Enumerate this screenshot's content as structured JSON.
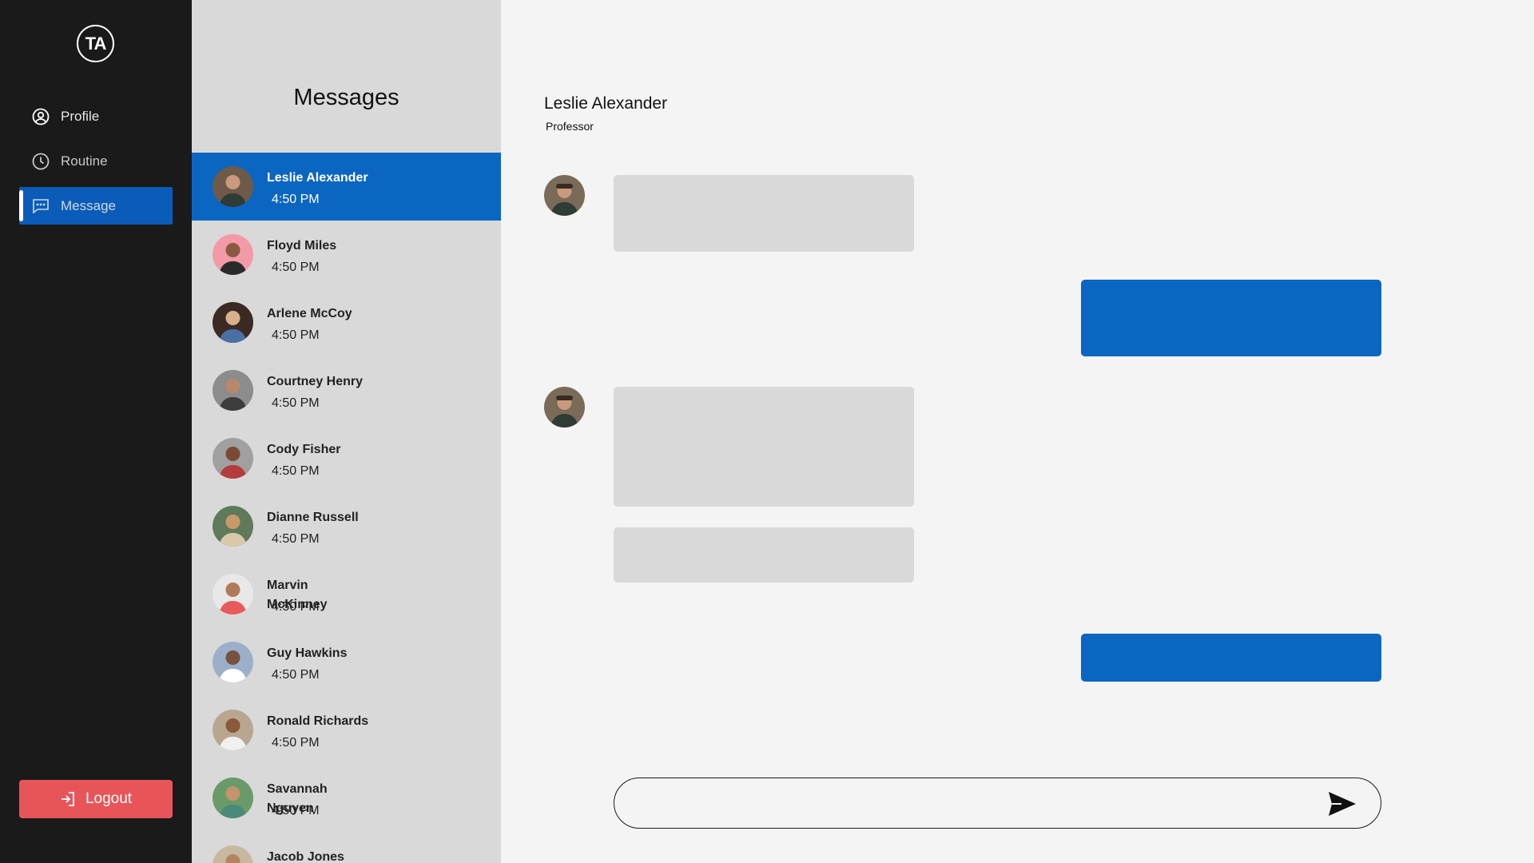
{
  "sidebar": {
    "logo_text": "TA",
    "items": [
      {
        "label": "Profile",
        "icon": "user-circle-icon"
      },
      {
        "label": "Routine",
        "icon": "clock-icon"
      },
      {
        "label": "Message",
        "icon": "chat-icon",
        "active": true
      }
    ],
    "logout_label": "Logout",
    "logout_icon": "login-arrow-icon"
  },
  "contacts": {
    "title": "Messages",
    "items": [
      {
        "name": "Leslie Alexander",
        "time": "4:50 PM",
        "active": true
      },
      {
        "name": "Floyd Miles",
        "time": "4:50 PM"
      },
      {
        "name": "Arlene McCoy",
        "time": "4:50 PM"
      },
      {
        "name": "Courtney Henry",
        "time": "4:50 PM"
      },
      {
        "name": "Cody Fisher",
        "time": "4:50 PM"
      },
      {
        "name": "Dianne Russell",
        "time": "4:50 PM"
      },
      {
        "name": "Marvin McKinney",
        "time": "4:50 PM"
      },
      {
        "name": "Guy Hawkins",
        "time": "4:50 PM"
      },
      {
        "name": "Ronald Richards",
        "time": "4:50 PM"
      },
      {
        "name": "Savannah Nguyen",
        "time": "4:50 PM"
      },
      {
        "name": "Jacob Jones",
        "time": ""
      }
    ]
  },
  "chat": {
    "name": "Leslie Alexander",
    "role": "Professor",
    "composer_placeholder": "",
    "send_icon": "send-icon"
  },
  "colors": {
    "accent": "#0b66c2",
    "sidebar_bg": "#1a1a1a",
    "logout": "#e85559",
    "list_bg": "#d9d9d9"
  }
}
